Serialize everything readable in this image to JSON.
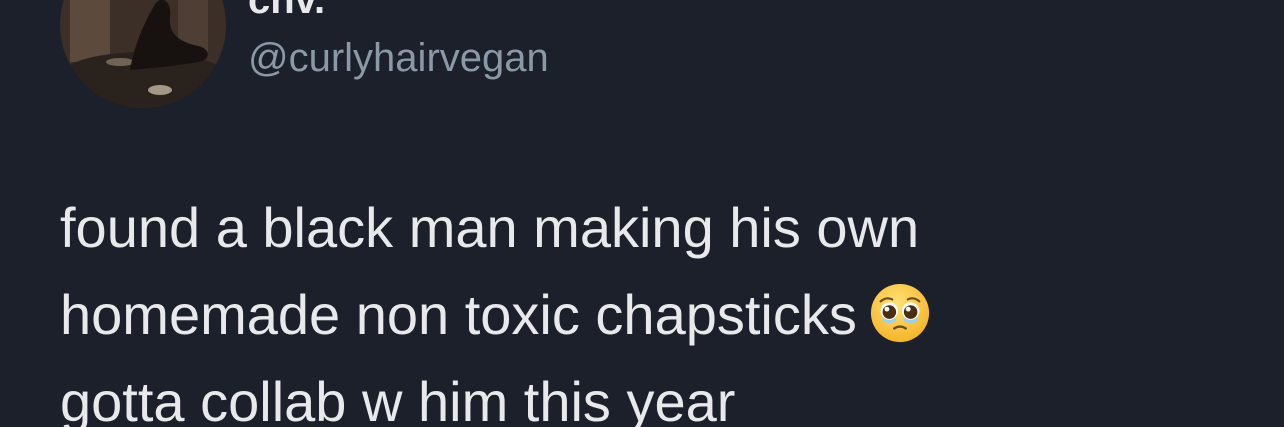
{
  "tweet": {
    "author": {
      "display_name": "cnv.",
      "handle": "@curlyhairvegan",
      "avatar_icon": "profile-photo"
    },
    "text_lines": [
      "found a black man making his own",
      "homemade non toxic chapsticks",
      "gotta collab w him this year"
    ],
    "emoji": "face-holding-back-tears-icon",
    "colors": {
      "background": "#1b202a",
      "primary_text": "#e7e9ea",
      "secondary_text": "#8b98a5"
    }
  }
}
